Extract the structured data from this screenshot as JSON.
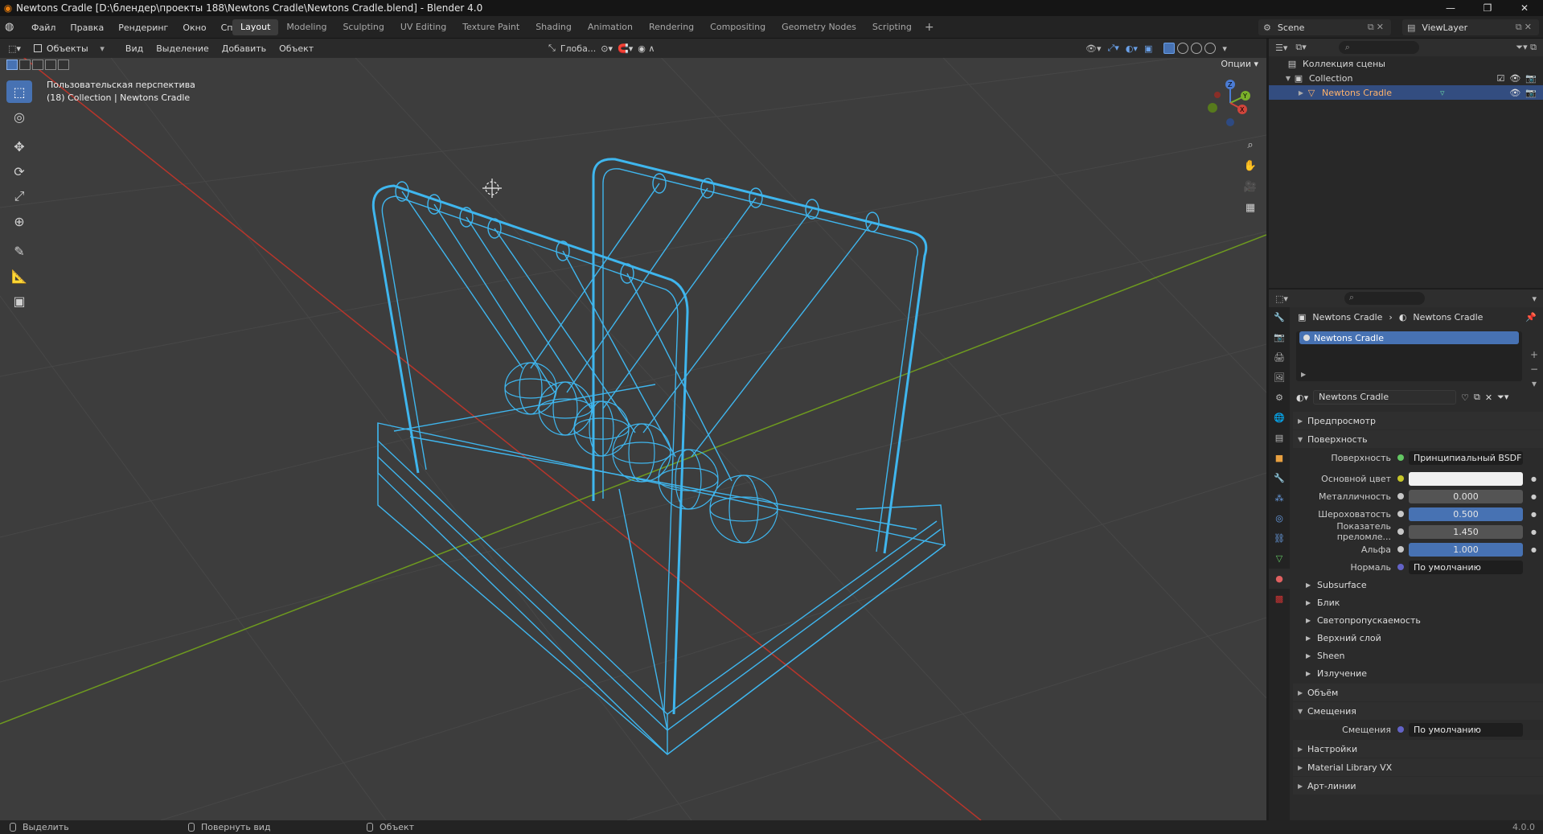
{
  "window": {
    "title": "Newtons Cradle [D:\\блендер\\проекты 188\\Newtons Cradle\\Newtons Cradle.blend] - Blender 4.0",
    "controls": [
      "—",
      "❐",
      "✕"
    ]
  },
  "menubar": {
    "menus": [
      "Файл",
      "Правка",
      "Рендеринг",
      "Окно",
      "Справка"
    ],
    "tabs": [
      "Layout",
      "Modeling",
      "Sculpting",
      "UV Editing",
      "Texture Paint",
      "Shading",
      "Animation",
      "Rendering",
      "Compositing",
      "Geometry Nodes",
      "Scripting"
    ],
    "active_tab": "Layout",
    "scene": "Scene",
    "view_layer": "ViewLayer"
  },
  "viewport": {
    "mode": "Объекты",
    "menus": [
      "Вид",
      "Выделение",
      "Добавить",
      "Объект"
    ],
    "orientation": "Глоба...",
    "options": "Опции",
    "info_line1": "Пользовательская перспектива",
    "info_line2": "(18) Collection | Newtons Cradle",
    "wire_color": "#3fb6ee",
    "grid_x_color": "#c0392b",
    "grid_y_color": "#6e9a1f"
  },
  "toolbar": {
    "tools": [
      "select-box",
      "cursor",
      "move",
      "rotate",
      "scale",
      "transform",
      "annotate",
      "measure",
      "add-cube"
    ]
  },
  "gizmo": {
    "axes": [
      "Z",
      "Y",
      "X"
    ]
  },
  "outliner": {
    "scene_collection": "Коллекция сцены",
    "collection": "Collection",
    "object": "Newtons Cradle"
  },
  "properties": {
    "breadcrumb_object": "Newtons Cradle",
    "breadcrumb_material": "Newtons Cradle",
    "material_slot": "Newtons Cradle",
    "material_name": "Newtons Cradle",
    "panels": {
      "preview": "Предпросмотр",
      "surface": "Поверхность",
      "volume": "Объём",
      "displacement": "Смещения",
      "settings": "Настройки",
      "material_library": "Material Library VX",
      "lineart": "Арт-линии"
    },
    "surface_rows": [
      {
        "label": "Поверхность",
        "value": "Принципиальный BSDF",
        "dot": "green",
        "style": "dark"
      },
      {
        "label": "Основной цвет",
        "value": "",
        "dot": "yellow",
        "style": "white"
      },
      {
        "label": "Металличность",
        "value": "0.000",
        "dot": "grey",
        "style": "grey"
      },
      {
        "label": "Шероховатость",
        "value": "0.500",
        "dot": "grey",
        "style": "blue"
      },
      {
        "label": "Показатель преломле...",
        "value": "1.450",
        "dot": "grey",
        "style": "grey"
      },
      {
        "label": "Альфа",
        "value": "1.000",
        "dot": "grey",
        "style": "blue"
      },
      {
        "label": "Нормаль",
        "value": "По умолчанию",
        "dot": "purple",
        "style": "dark"
      }
    ],
    "subpanels": [
      "Subsurface",
      "Блик",
      "Светопропускаемость",
      "Верхний слой",
      "Sheen",
      "Излучение"
    ],
    "displacement_label": "Смещения",
    "displacement_value": "По умолчанию"
  },
  "statusbar": {
    "items": [
      "Выделить",
      "Повернуть вид",
      "Объект"
    ],
    "version": "4.0.0"
  }
}
